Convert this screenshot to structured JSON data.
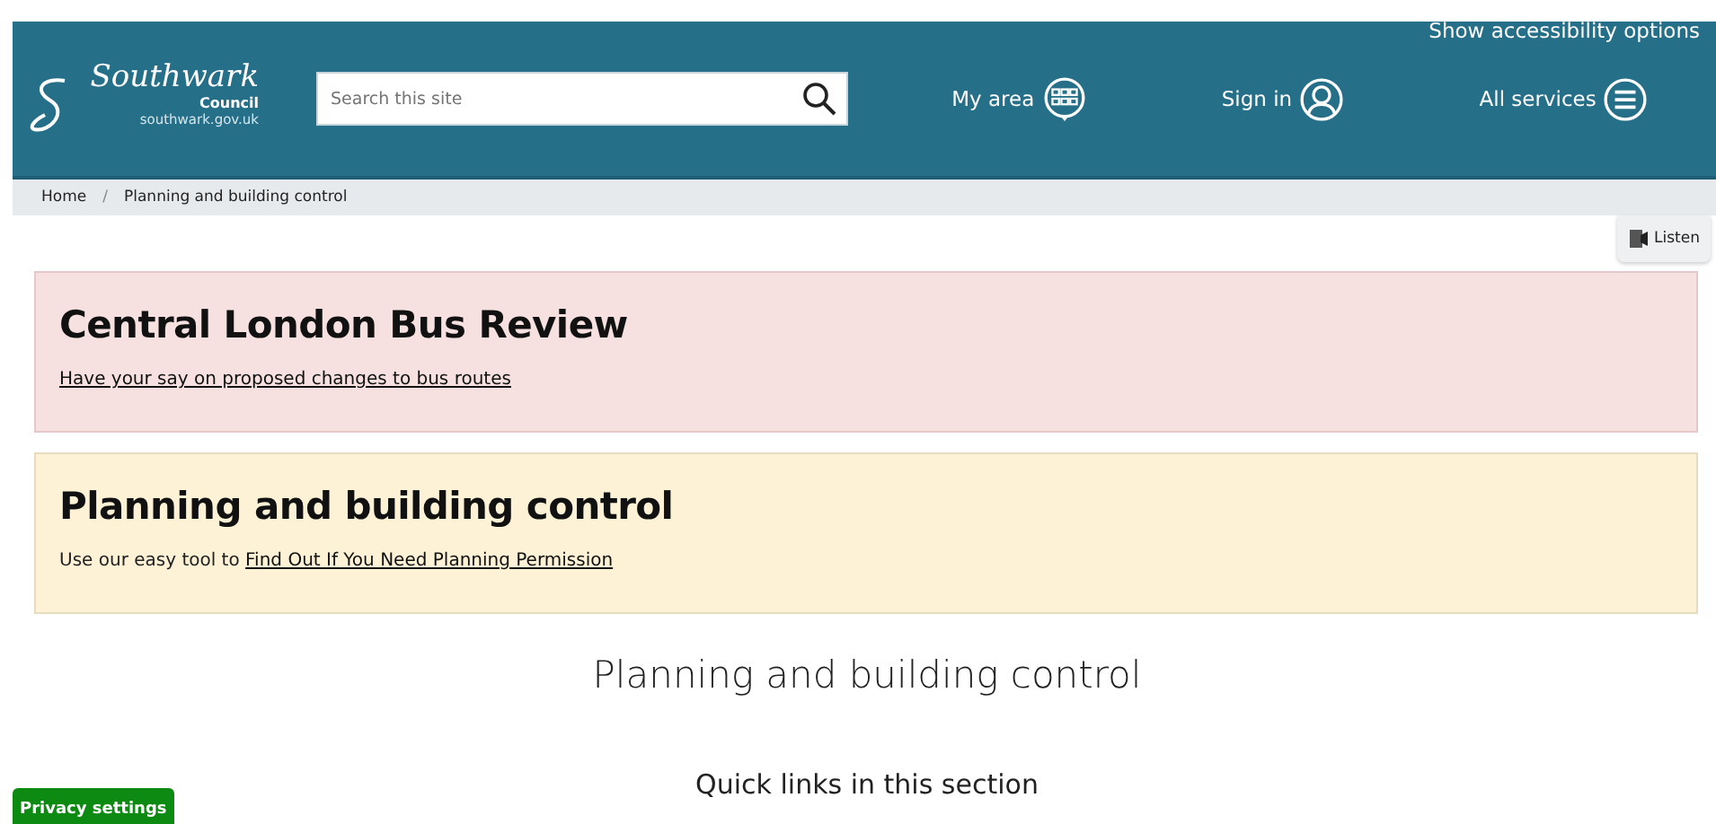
{
  "header": {
    "logo": {
      "script": "Southwark",
      "council": "Council",
      "domain": "southwark.gov.uk"
    },
    "accessibility_link": "Show accessibility options",
    "search": {
      "placeholder": "Search this site"
    },
    "nav": [
      {
        "label": "My area",
        "kind": "grid"
      },
      {
        "label": "Sign in",
        "kind": "person"
      },
      {
        "label": "All services",
        "kind": "menu"
      }
    ]
  },
  "breadcrumb": [
    {
      "label": "Home"
    },
    {
      "label": "Planning and building control"
    }
  ],
  "breadcrumb_separator": "/",
  "listen_button": "Listen",
  "banners": [
    {
      "kind": "alert",
      "title": "Central London Bus Review",
      "link": "Have your say on proposed changes to bus routes"
    },
    {
      "kind": "notice",
      "title": "Planning and building control",
      "text": "Use our easy tool to ",
      "link": "Find Out If You Need Planning Permission"
    }
  ],
  "page_title": "Planning and building control",
  "section_heading": "Quick links in this section",
  "privacy_button": "Privacy settings"
}
